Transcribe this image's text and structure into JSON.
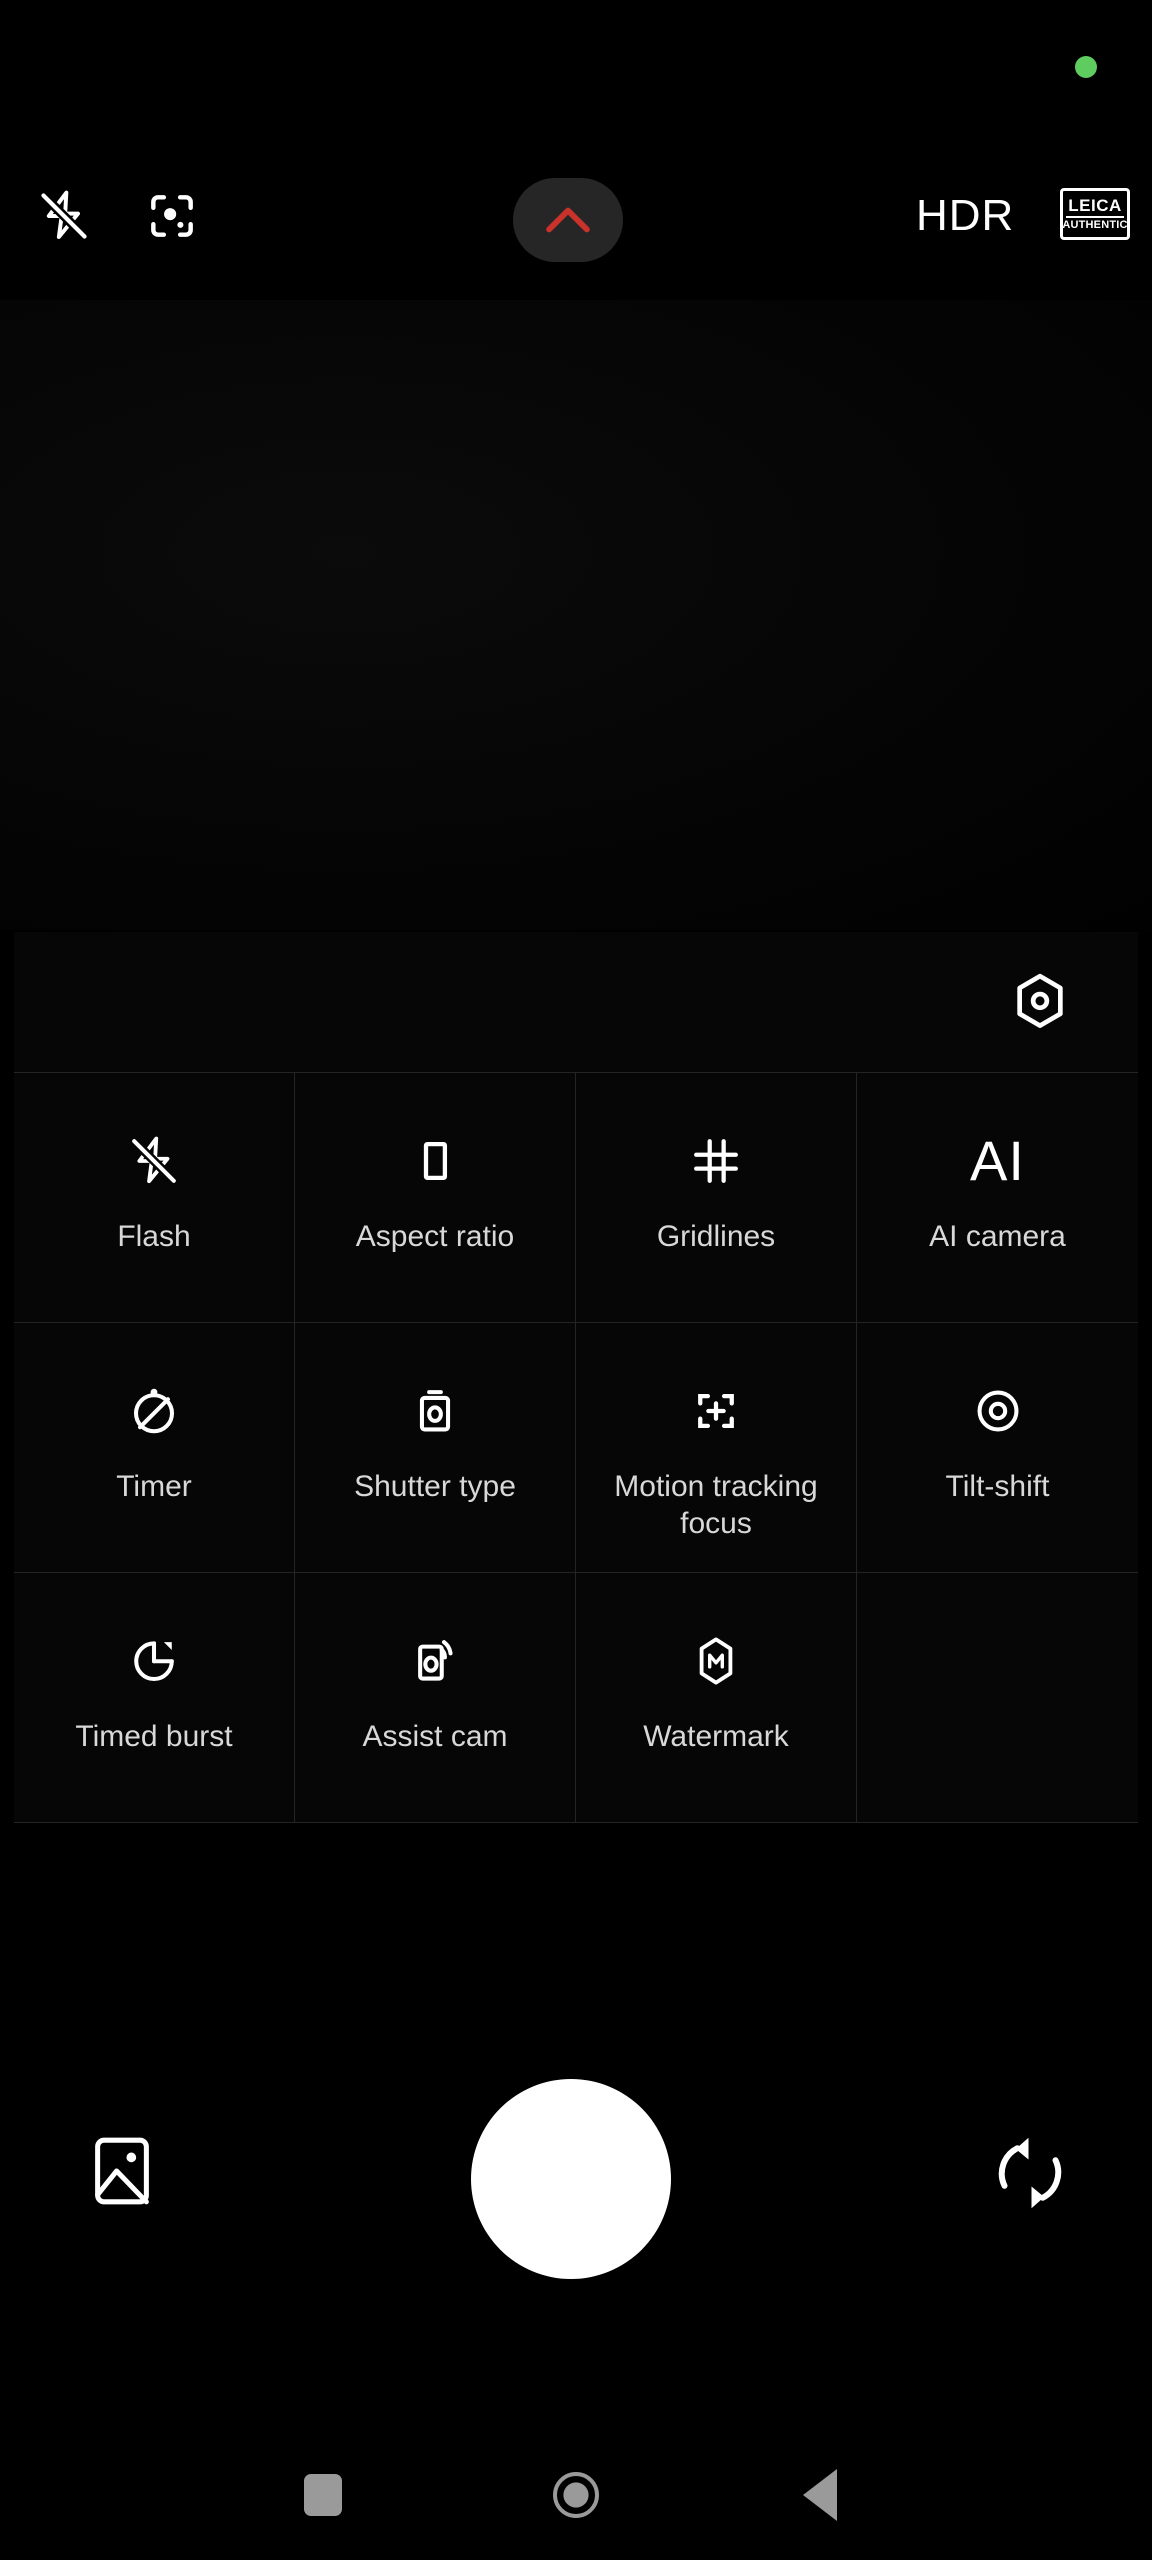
{
  "app": {
    "name": "Camera",
    "theme_background": "#000000",
    "panel_background": "#060606",
    "divider_color": "#242424",
    "accent_color": "#c8322a",
    "privacy_dot_color": "#5ECC5E",
    "label_color": "#d8d8d8",
    "shutter_color": "#ffffff",
    "nav_icon_color": "#9a9a9a"
  },
  "status": {
    "privacy_indicator": "green-dot",
    "privacy_indicator_name": "camera-in-use-indicator"
  },
  "topbar": {
    "flash": {
      "icon": "flash-off-icon",
      "state": "off"
    },
    "ai_scan": {
      "icon": "ai-scan-icon",
      "label": ""
    },
    "expand": {
      "icon": "chevron-up-icon",
      "label": "",
      "accent": "#c8322a"
    },
    "hdr": {
      "label": "HDR",
      "icon": "hdr-label"
    },
    "leica": {
      "line1": "LEICA",
      "line2": "AUTHENTIC",
      "icon": "leica-authentic-badge"
    }
  },
  "viewfinder": {
    "state": "dark-preview",
    "description": ""
  },
  "settings_panel": {
    "header": {
      "gear": {
        "icon": "hexagon-settings-icon",
        "label": ""
      }
    },
    "items": [
      {
        "id": "flash",
        "label": "Flash",
        "icon": "flash-off-icon"
      },
      {
        "id": "aspect-ratio",
        "label": "Aspect ratio",
        "icon": "rectangle-icon"
      },
      {
        "id": "gridlines",
        "label": "Gridlines",
        "icon": "grid-icon"
      },
      {
        "id": "ai-camera",
        "label": "AI camera",
        "icon": "ai-text-icon",
        "icon_text": "AI"
      },
      {
        "id": "timer",
        "label": "Timer",
        "icon": "timer-off-icon"
      },
      {
        "id": "shutter-type",
        "label": "Shutter type",
        "icon": "shutter-type-icon"
      },
      {
        "id": "motion-focus",
        "label": "Motion\ntracking focus",
        "icon": "motion-tracking-focus-icon"
      },
      {
        "id": "tilt-shift",
        "label": "Tilt-shift",
        "icon": "tilt-shift-icon"
      },
      {
        "id": "timed-burst",
        "label": "Timed burst",
        "icon": "timed-burst-icon"
      },
      {
        "id": "assist-cam",
        "label": "Assist cam",
        "icon": "assist-cam-icon"
      },
      {
        "id": "watermark",
        "label": "Watermark",
        "icon": "watermark-m-icon"
      },
      {
        "id": "empty",
        "label": "",
        "icon": ""
      }
    ]
  },
  "bottom_controls": {
    "gallery": {
      "icon": "gallery-thumbnail-icon",
      "label": ""
    },
    "shutter": {
      "icon": "shutter-button",
      "label": ""
    },
    "flip": {
      "icon": "camera-flip-icon",
      "label": ""
    }
  },
  "navbar": {
    "recents": {
      "icon": "recents-square-icon",
      "label": ""
    },
    "home": {
      "icon": "home-circle-icon",
      "label": ""
    },
    "back": {
      "icon": "back-triangle-icon",
      "label": ""
    }
  }
}
